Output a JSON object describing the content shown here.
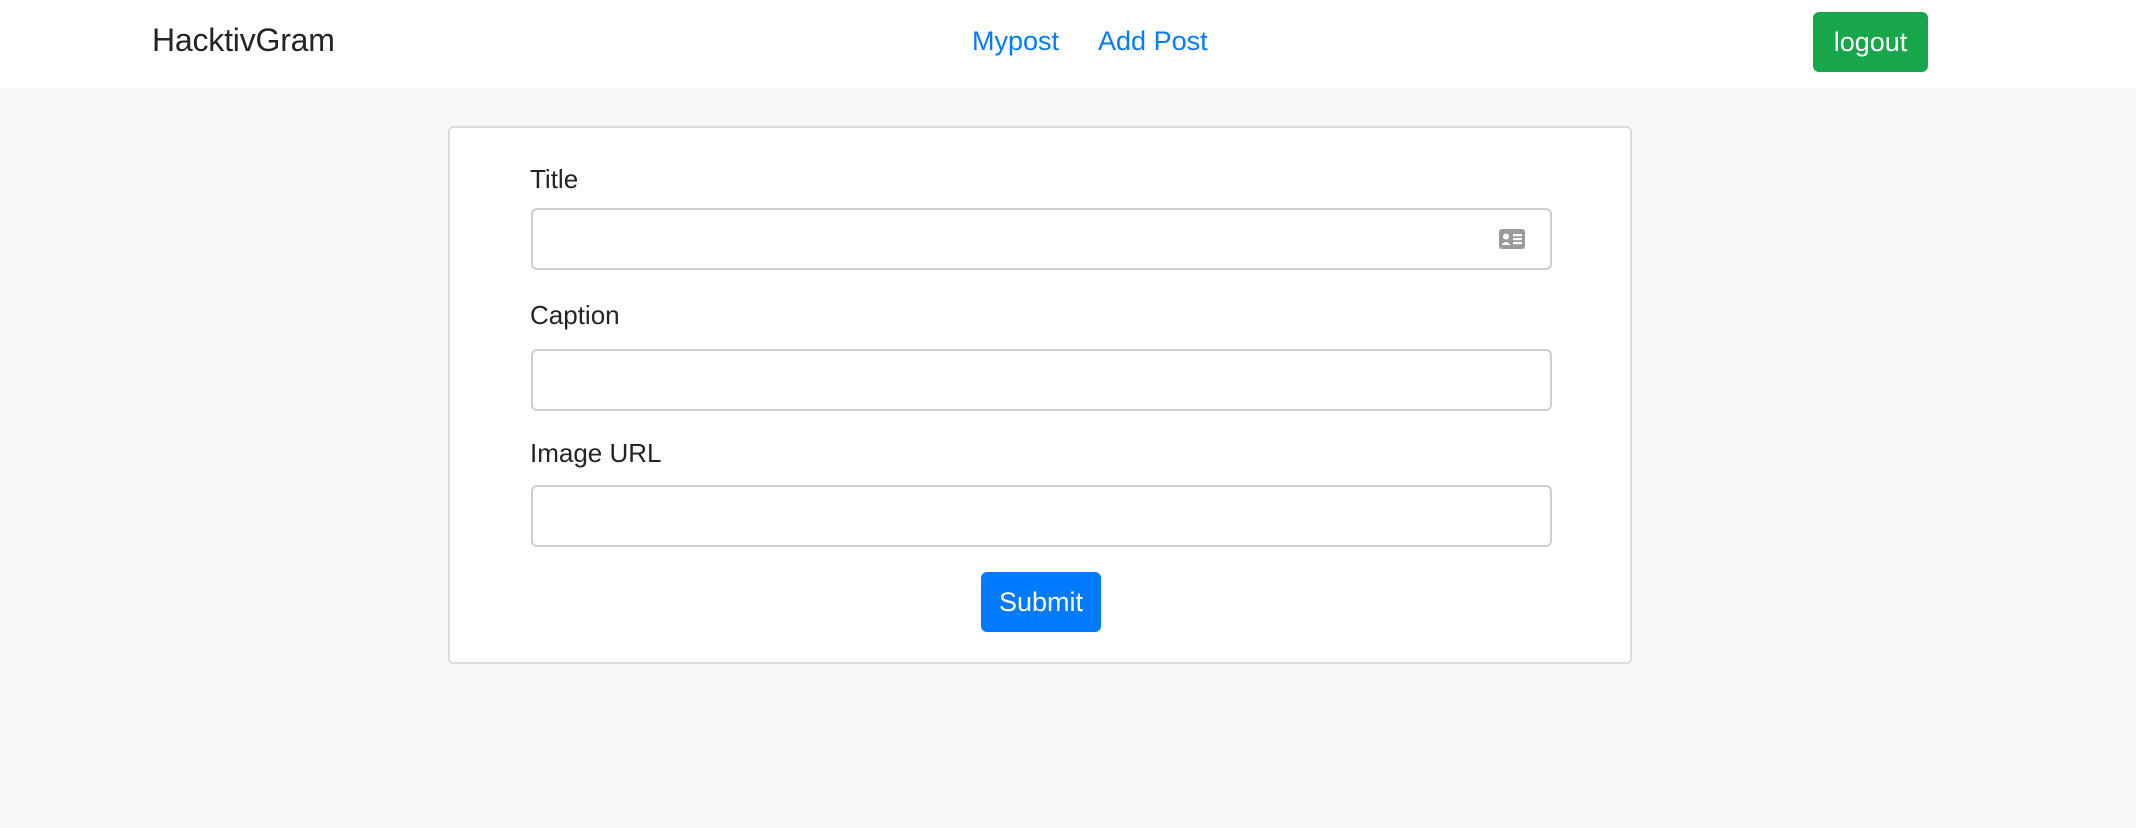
{
  "navbar": {
    "brand": "HacktivGram",
    "links": [
      {
        "label": "Mypost"
      },
      {
        "label": "Add Post"
      }
    ],
    "logout_label": "logout"
  },
  "form": {
    "fields": [
      {
        "label": "Title",
        "value": "",
        "icon": "contact-card-icon"
      },
      {
        "label": "Caption",
        "value": ""
      },
      {
        "label": "Image URL",
        "value": ""
      }
    ],
    "submit_label": "Submit"
  },
  "colors": {
    "link": "#007bff",
    "logout_button": "#17a74a",
    "submit_button": "#007bff",
    "page_background": "#f8f8f8"
  }
}
